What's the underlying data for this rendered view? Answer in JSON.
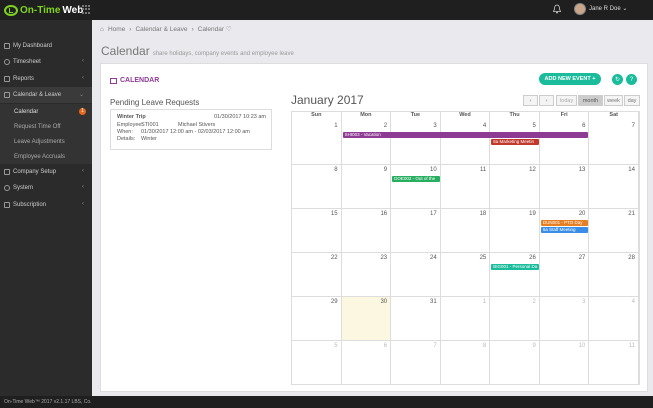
{
  "topbar": {
    "logo_text": "On-Time",
    "logo_web": "Web",
    "user_name": "Jane R Doe ⌄",
    "accent": "#7ed321"
  },
  "sidebar": {
    "items": [
      {
        "label": "My Dashboard",
        "icon": "dashboard-icon"
      },
      {
        "label": "Timesheet",
        "icon": "clock-icon"
      },
      {
        "label": "Reports",
        "icon": "bar-chart-icon"
      },
      {
        "label": "Calendar & Leave",
        "icon": "calendar-icon"
      },
      {
        "label": "Company Setup",
        "icon": "building-icon"
      },
      {
        "label": "System",
        "icon": "gear-icon"
      },
      {
        "label": "Subscription",
        "icon": "card-icon"
      }
    ],
    "subitems": [
      {
        "label": "Calendar",
        "badge": "1"
      },
      {
        "label": "Request Time Off"
      },
      {
        "label": "Leave Adjustments"
      },
      {
        "label": "Employee Accruals"
      }
    ]
  },
  "breadcrumb": {
    "home": "Home",
    "sep1": "›",
    "section": "Calendar & Leave",
    "sep2": "›",
    "current": "Calendar ♡"
  },
  "page": {
    "title": "Calendar",
    "subtitle": "share holidays, company events and employee leave"
  },
  "panel": {
    "header": "CALENDAR",
    "add_event": "ADD NEW EVENT +"
  },
  "pending": {
    "title": "Pending Leave Requests",
    "card": {
      "name": "Winter Trip",
      "date": "01/30/2017 10:23 am",
      "emp_label": "Employee:",
      "emp_id": "STI001",
      "emp_name": "Michael Stivers",
      "when_label": "When:",
      "when": "01/30/2017 12:00 am - 02/03/2017 12:00 am",
      "details_label": "Details:",
      "details": "Winter"
    }
  },
  "calendar": {
    "month_title": "January 2017",
    "prev": "‹",
    "next": "›",
    "today": "today",
    "views": [
      "month",
      "week",
      "day"
    ],
    "active_view": "month",
    "dow": [
      "Sun",
      "Mon",
      "Tue",
      "Wed",
      "Thu",
      "Fri",
      "Sat"
    ],
    "weeks": [
      [
        "1",
        "2",
        "3",
        "4",
        "5",
        "6",
        "7"
      ],
      [
        "8",
        "9",
        "10",
        "11",
        "12",
        "13",
        "14"
      ],
      [
        "15",
        "16",
        "17",
        "18",
        "19",
        "20",
        "21"
      ],
      [
        "22",
        "23",
        "24",
        "25",
        "26",
        "27",
        "28"
      ],
      [
        "29",
        "30",
        "31",
        "1",
        "2",
        "3",
        "4"
      ],
      [
        "5",
        "6",
        "7",
        "8",
        "9",
        "10",
        "11"
      ]
    ],
    "events": [
      {
        "text": "SHI003 - Vacation",
        "week": 0,
        "start": 1,
        "span": 5,
        "row": 0,
        "color": "#8e3b94"
      },
      {
        "text": "6a Marketing Meetin",
        "week": 0,
        "start": 4,
        "span": 1,
        "row": 1,
        "color": "#c0392b"
      },
      {
        "text": "DOE002 - Out of the",
        "week": 1,
        "start": 2,
        "span": 1,
        "row": 0,
        "color": "#27ae60"
      },
      {
        "text": "DUN001 - PTO Day",
        "week": 2,
        "start": 5,
        "span": 1,
        "row": 0,
        "color": "#e67e22"
      },
      {
        "text": "6a Staff Meeting",
        "week": 2,
        "start": 5,
        "span": 1,
        "row": 1,
        "color": "#3a8ee6"
      },
      {
        "text": "BIG001 - Personal Da",
        "week": 3,
        "start": 4,
        "span": 1,
        "row": 0,
        "color": "#1abc9c"
      }
    ]
  },
  "footer": {
    "version": "On-Time Web™ 2017 v2.1.17    LBS, Co."
  }
}
